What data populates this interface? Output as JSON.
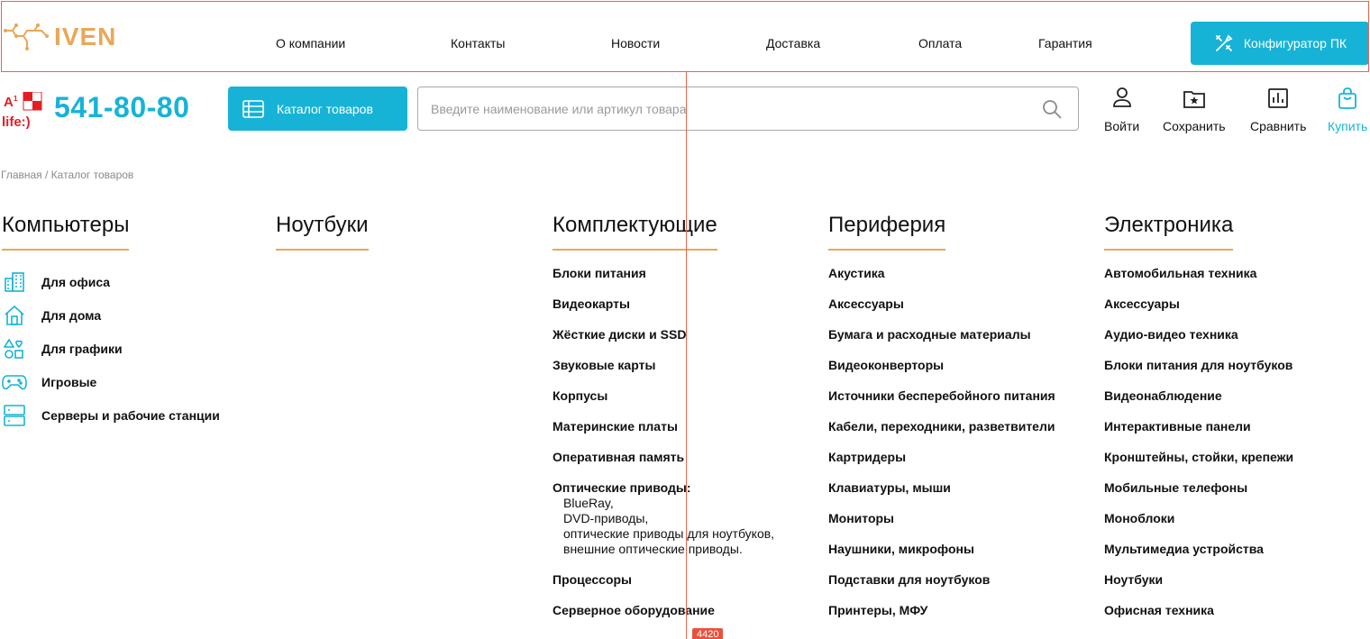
{
  "brand": {
    "name": "IVEN",
    "color": "#e8a857",
    "accent": "#17b3d7"
  },
  "nav": {
    "about": "О компании",
    "contacts": "Контакты",
    "news": "Новости",
    "delivery": "Доставка",
    "payment": "Оплата",
    "warranty": "Гарантия"
  },
  "configurator": {
    "label": "Конфигуратор ПК",
    "icon": "tools-icon"
  },
  "phone": {
    "number": "541-80-80",
    "operators": [
      "A1",
      "МТС",
      "life:)"
    ]
  },
  "catalog_button": {
    "label": "Каталог товаров",
    "icon": "list-icon"
  },
  "search": {
    "placeholder": "Введите наименование или артикул товара",
    "icon": "search-icon"
  },
  "actions": {
    "login": "Войти",
    "save": "Сохранить",
    "compare": "Сравнить",
    "buy": "Купить"
  },
  "breadcrumb": "Главная / Каталог товаров",
  "columns": {
    "computers": {
      "title": "Компьютеры",
      "items": [
        {
          "label": "Для офиса",
          "icon": "building-icon"
        },
        {
          "label": "Для дома",
          "icon": "house-icon"
        },
        {
          "label": "Для графики",
          "icon": "shapes-icon"
        },
        {
          "label": "Игровые",
          "icon": "gamepad-icon"
        },
        {
          "label": "Серверы и рабочие станции",
          "icon": "server-icon"
        }
      ]
    },
    "laptops": {
      "title": "Ноутбуки"
    },
    "components": {
      "title": "Комплектующие",
      "items": [
        "Блоки питания",
        "Видеокарты",
        "Жёсткие диски и SSD",
        "Звуковые карты",
        "Корпусы",
        "Материнские платы",
        "Оперативная память"
      ],
      "optical": {
        "label": "Оптические приводы:",
        "sub": [
          "BlueRay,",
          "DVD-приводы,",
          "оптические приводы для ноутбуков,",
          "внешние оптические приводы."
        ]
      },
      "items2": [
        "Процессоры",
        "Серверное оборудование"
      ],
      "badge": "4420"
    },
    "periphery": {
      "title": "Периферия",
      "items": [
        "Акустика",
        "Аксессуары",
        "Бумага и расходные материалы",
        "Видеоконверторы",
        "Источники бесперебойного питания",
        "Кабели, переходники, разветвители",
        "Картридеры",
        "Клавиатуры, мыши",
        "Мониторы",
        "Наушники, микрофоны",
        "Подставки для ноутбуков",
        "Принтеры, МФУ"
      ]
    },
    "electronics": {
      "title": "Электроника",
      "items": [
        "Автомобильная техника",
        "Аксессуары",
        "Аудио-видео техника",
        "Блоки питания для ноутбуков",
        "Видеонаблюдение",
        "Интерактивные панели",
        "Кронштейны, стойки, крепежи",
        "Мобильные телефоны",
        "Моноблоки",
        "Мультимедиа устройства",
        "Ноутбуки",
        "Офисная техника"
      ]
    }
  }
}
